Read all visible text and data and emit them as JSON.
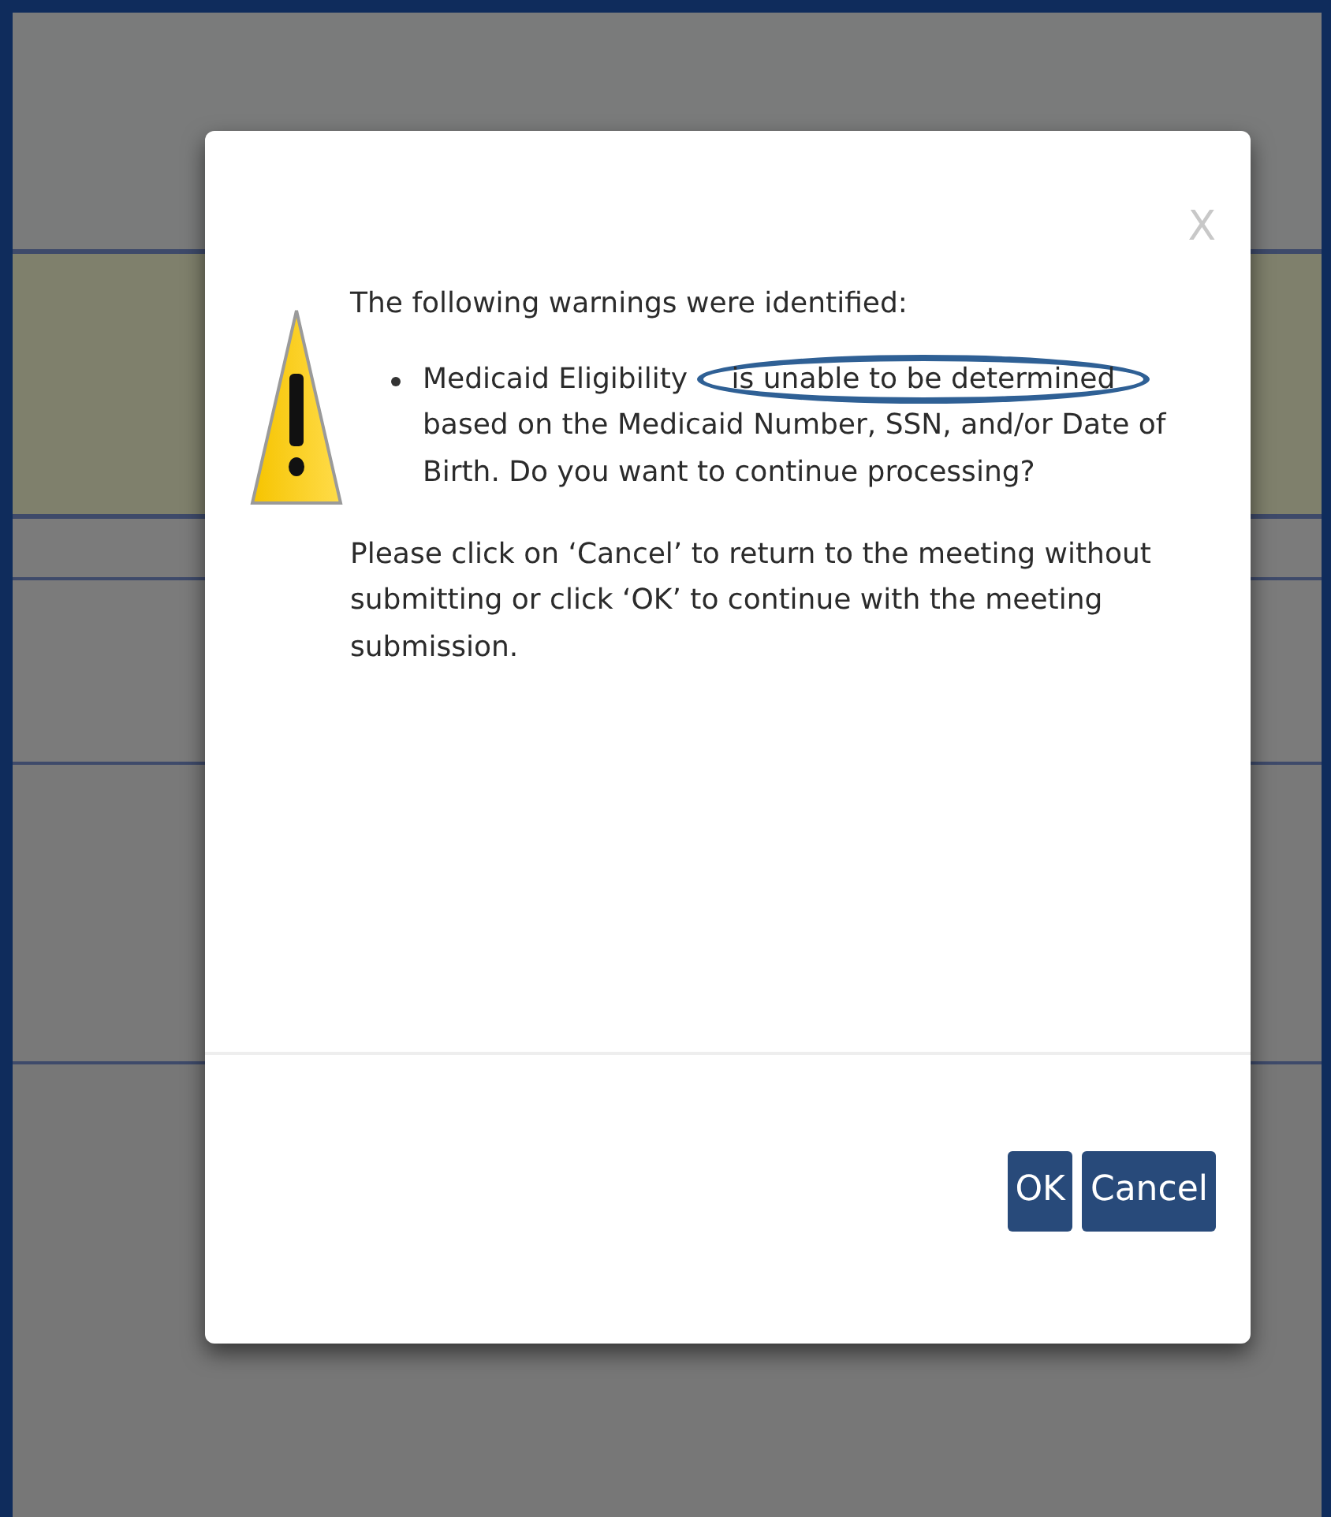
{
  "dialog": {
    "close": "X",
    "heading": "The following warnings were identified:",
    "warnings": [
      {
        "before": "Medicaid Eligibility ",
        "circled": "is unable to be determined",
        "after": " based on the Medicaid Number, SSN, and/or Date of Birth. Do you want to continue processing?"
      }
    ],
    "instruction": "Please click on ‘Cancel’ to return to the meeting without submitting or click ‘OK’ to continue with the meeting submission.",
    "buttons": [
      "OK",
      "Cancel"
    ]
  }
}
